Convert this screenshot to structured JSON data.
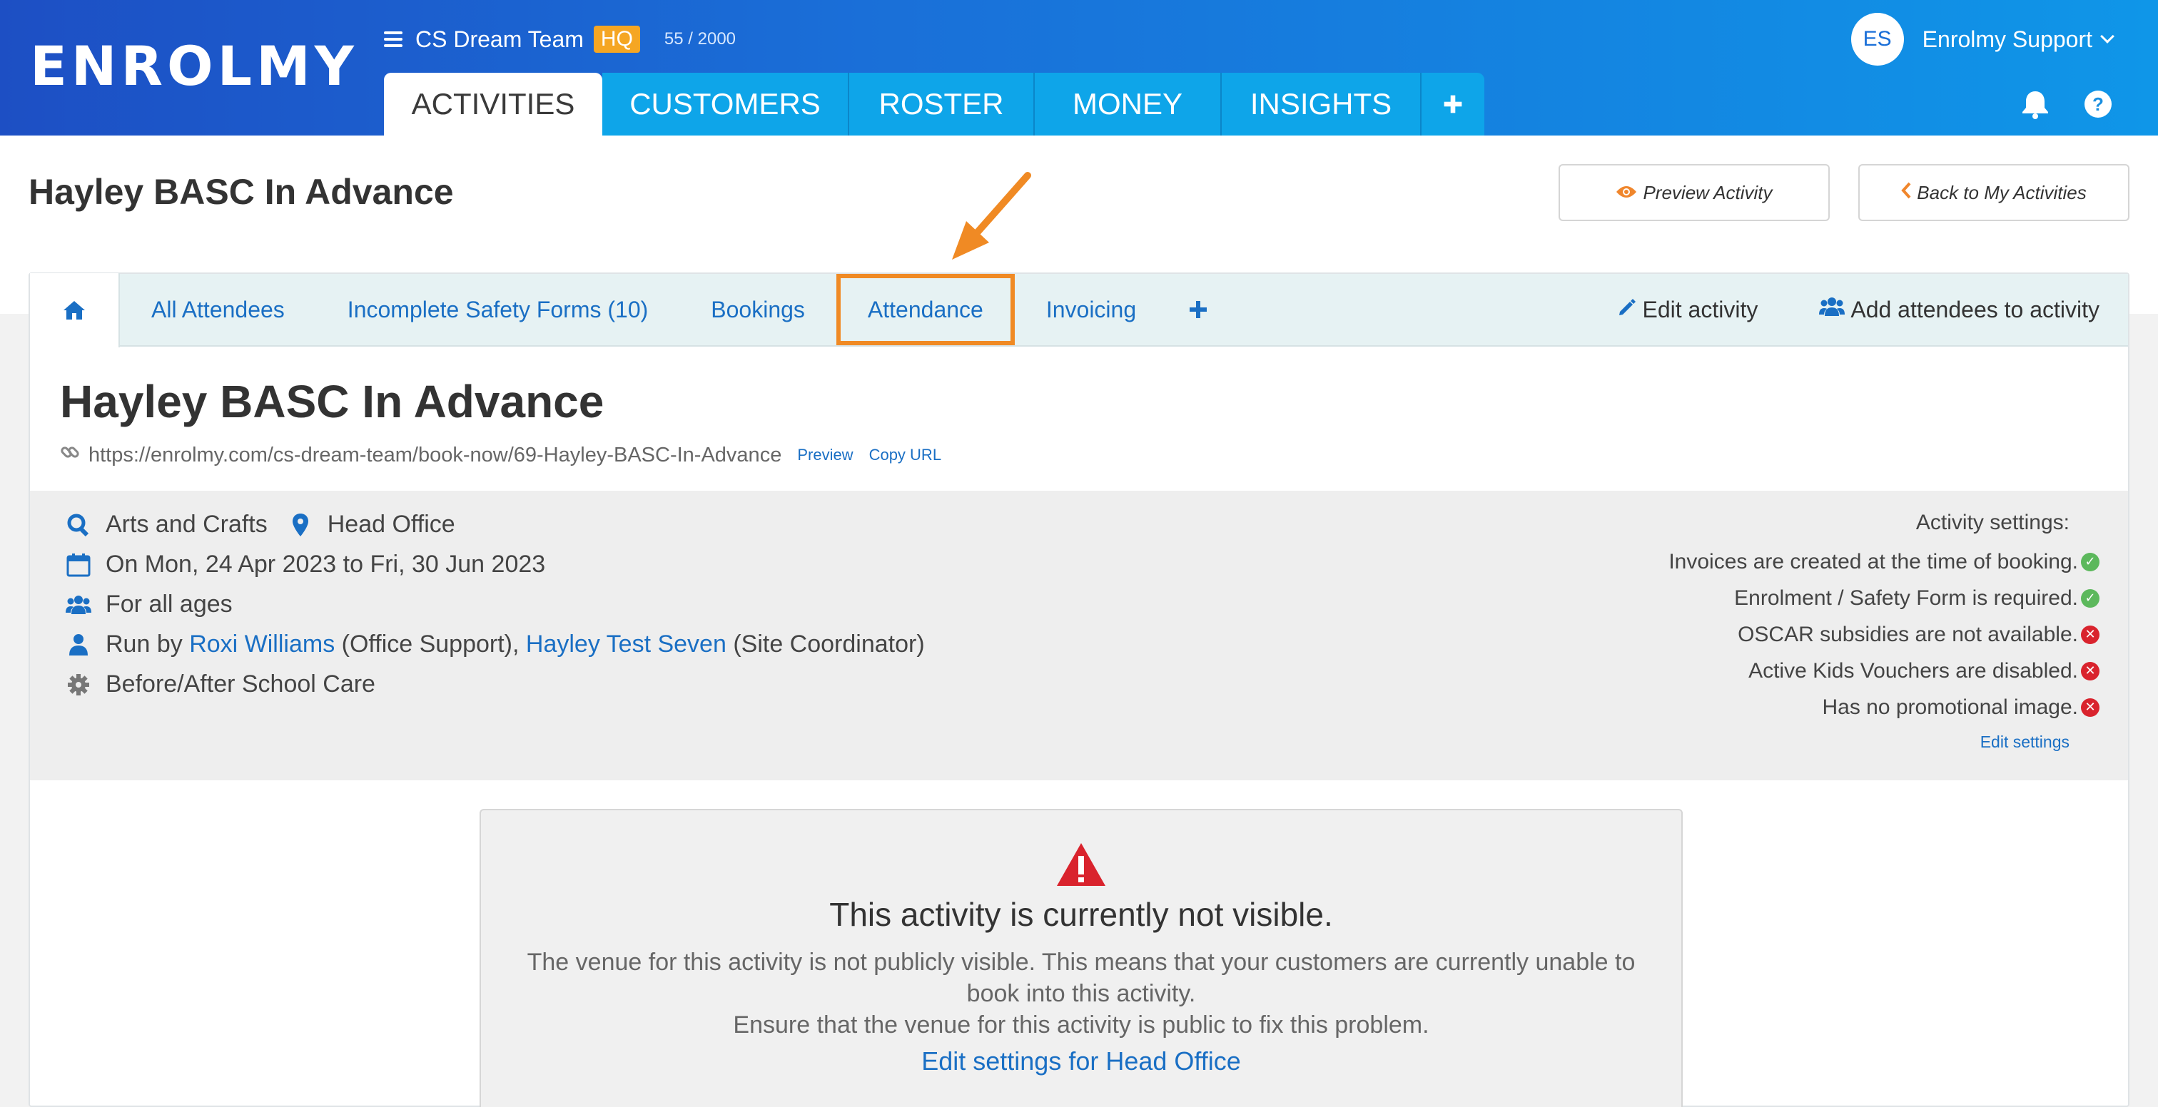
{
  "header": {
    "logo": "ENROLMY",
    "org_name": "CS Dream Team",
    "org_badge": "HQ",
    "count": "55 / 2000",
    "avatar_initials": "ES",
    "user_name": "Enrolmy Support",
    "tabs": [
      {
        "label": "ACTIVITIES",
        "active": true
      },
      {
        "label": "CUSTOMERS"
      },
      {
        "label": "ROSTER"
      },
      {
        "label": "MONEY"
      },
      {
        "label": "INSIGHTS"
      }
    ]
  },
  "page": {
    "title": "Hayley BASC In Advance",
    "preview_btn": "Preview Activity",
    "back_btn": "Back to My Activities"
  },
  "subnav": {
    "tabs": [
      "All Attendees",
      "Incomplete Safety Forms (10)",
      "Bookings",
      "Attendance",
      "Invoicing"
    ],
    "edit_activity": "Edit activity",
    "add_attendees": "Add attendees to activity"
  },
  "activity": {
    "title": "Hayley BASC In Advance",
    "url": "https://enrolmy.com/cs-dream-team/book-now/69-Hayley-BASC-In-Advance",
    "preview_link": "Preview",
    "copy_link": "Copy URL",
    "category": "Arts and Crafts",
    "venue": "Head Office",
    "dates": "On Mon, 24 Apr 2023 to Fri, 30 Jun 2023",
    "ages": "For all ages",
    "run_by_prefix": "Run by",
    "staff1_name": "Roxi Williams",
    "staff1_role": "(Office Support),",
    "staff2_name": "Hayley Test Seven",
    "staff2_role": "(Site Coordinator)",
    "type": "Before/After School Care"
  },
  "settings": {
    "title": "Activity settings:",
    "items": [
      {
        "text": "Invoices are created at the time of booking.",
        "status": "ok"
      },
      {
        "text": "Enrolment / Safety Form is required.",
        "status": "ok"
      },
      {
        "text": "OSCAR subsidies are not available.",
        "status": "no"
      },
      {
        "text": "Active Kids Vouchers are disabled.",
        "status": "no"
      },
      {
        "text": "Has no promotional image.",
        "status": "no"
      }
    ],
    "edit_link": "Edit settings"
  },
  "warning": {
    "title": "This activity is currently not visible.",
    "line1": "The venue for this activity is not publicly visible. This means that your customers are currently unable to book into this activity.",
    "line2": "Ensure that the venue for this activity is public to fix this problem.",
    "link": "Edit settings for Head Office"
  },
  "colors": {
    "brand_blue": "#1a6fd8",
    "tab_blue": "#0ea5e9",
    "link": "#1a6fc4",
    "highlight": "#f08a24",
    "ok": "#5cb85c",
    "error": "#d9232d"
  }
}
